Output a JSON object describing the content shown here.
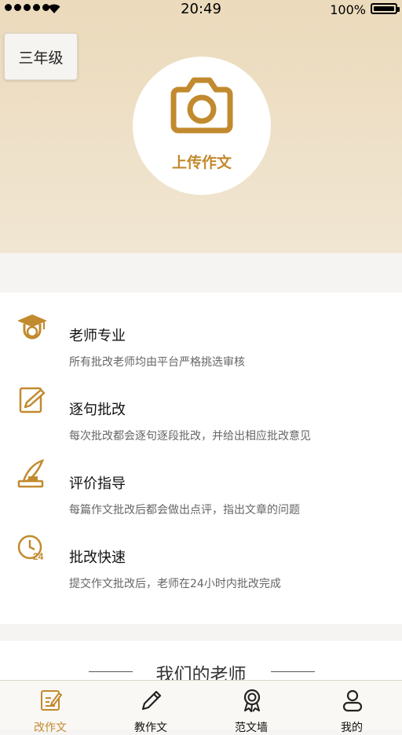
{
  "status_bar": {
    "time": "20:49",
    "battery": "100%"
  },
  "hero": {
    "grade_label": "三年级",
    "upload_label": "上传作文",
    "accent_color": "#c28a2e"
  },
  "features": [
    {
      "icon": "graduation-cap-icon",
      "title": "老师专业",
      "desc": "所有批改老师均由平台严格挑选审核"
    },
    {
      "icon": "edit-document-icon",
      "title": "逐句批改",
      "desc": "每次批改都会逐句逐段批改，并给出相应批改意见"
    },
    {
      "icon": "quill-inkpot-icon",
      "title": "评价指导",
      "desc": "每篇作文批改后都会做出点评，指出文章的问题"
    },
    {
      "icon": "clock-24-icon",
      "title": "批改快速",
      "desc": "提交作文批改后，老师在24小时内批改完成"
    }
  ],
  "teachers_section": {
    "title": "我们的老师"
  },
  "tabbar": {
    "tabs": [
      {
        "icon": "essay-edit-icon",
        "label": "改作文",
        "active": true
      },
      {
        "icon": "pencil-icon",
        "label": "教作文",
        "active": false
      },
      {
        "icon": "award-ribbon-icon",
        "label": "范文墙",
        "active": false
      },
      {
        "icon": "person-icon",
        "label": "我的",
        "active": false
      }
    ]
  }
}
